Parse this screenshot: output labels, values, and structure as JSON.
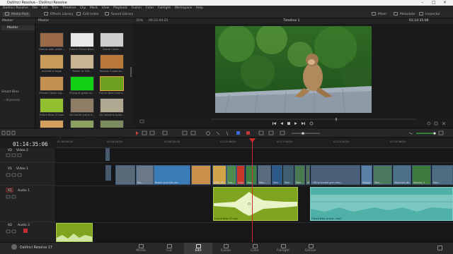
{
  "titlebar": {
    "title": "DaVinci Resolve - DaVinci Resolve"
  },
  "menu": [
    "DaVinci Resolve",
    "File",
    "Edit",
    "Trim",
    "Timeline",
    "Clip",
    "Mark",
    "View",
    "Playback",
    "Fusion",
    "Color",
    "Fairlight",
    "Workspace",
    "Help"
  ],
  "toolbar": {
    "media_pool": "Media Pool",
    "effects_library": "Effects Library",
    "edit_index": "Edit Index",
    "sound_library": "Sound Library",
    "mixer": "Mixer",
    "metadata": "Metadata",
    "inspector": "Inspector"
  },
  "bins": {
    "header": "Master",
    "selected": "Master",
    "smart_bins": "Smart Bins",
    "keywords": "Keywords"
  },
  "media_pool": {
    "header": "Master",
    "clips": [
      {
        "label": "Donuts with white...",
        "color": "#9a6a46"
      },
      {
        "label": "Dream Future Bass...",
        "color": "#e8e8e8"
      },
      {
        "label": "Drone Cloud...",
        "color": "#cfcfcf"
      },
      {
        "label": "excited to hope",
        "color": "#c89a58"
      },
      {
        "label": "Father to Gift...",
        "color": "#c8b490"
      },
      {
        "label": "Female Crowd ad...",
        "color": "#b87838"
      },
      {
        "label": "Female Clown ing...",
        "color": "#c49052"
      },
      {
        "label": "Flying at green sc...",
        "color": "#12d012"
      },
      {
        "label": "Future Bass (marri...",
        "color": "#6ea020"
      },
      {
        "label": "Future Bass 07.wav",
        "color": "#93c030"
      },
      {
        "label": "Girl bride scene h...",
        "color": "#8f7d66"
      },
      {
        "label": "Girl blowing bubb...",
        "color": "#b0a890"
      },
      {
        "label": "Girl close up in g...",
        "color": "#d4a060"
      },
      {
        "label": "Girl look shoots jp...",
        "color": "#8ca060"
      },
      {
        "label": "Girl look shoots jp...",
        "color": "#7c8c60"
      },
      {
        "label": "",
        "color": "#6e6e6e"
      },
      {
        "label": "",
        "color": "#5e5e5e"
      },
      {
        "label": "",
        "color": "#8e8e8e"
      }
    ]
  },
  "viewer": {
    "zoom": "35%",
    "timecode_left": "00:22:44:25",
    "timeline_name": "Timeline 1",
    "timecode_right": "01:14:35:06"
  },
  "timeline": {
    "timecode": "01:14:35:06",
    "ruler_ticks": [
      "01:00:00:00",
      "01:04:16:00",
      "01:08:32:00",
      "01:12:48:00",
      "01:17:04:00",
      "01:21:20:00",
      "01:25:36:00"
    ],
    "tracks": [
      {
        "id": "V2",
        "name": "Video 2"
      },
      {
        "id": "V1",
        "name": "Video 1"
      },
      {
        "id": "A1",
        "name": "Audio 1"
      },
      {
        "id": "A2",
        "name": "Audio 2"
      }
    ],
    "video_clips": [
      {
        "label": "",
        "color": "#5a6a78"
      },
      {
        "label": "Riv...",
        "color": "#6a7888"
      },
      {
        "label": "Beach and hills aer...",
        "color": "#3a7cb8"
      },
      {
        "label": "",
        "color": "#c99048"
      },
      {
        "label": "NEW_DE...",
        "color": "#d2a44a"
      },
      {
        "label": "Foo...",
        "color": "#4f8a50"
      },
      {
        "label": "Colo...",
        "color": "#c83828"
      },
      {
        "label": "Mon...",
        "color": "#3c8040"
      },
      {
        "label": "Mon...",
        "color": "#5a6b7e"
      },
      {
        "label": "Mon...",
        "color": "#2c5a88"
      },
      {
        "label": "Mon...",
        "color": "#406070"
      },
      {
        "label": "Mon...",
        "color": "#4a7a52"
      },
      {
        "label": "Mon...",
        "color": "#506e50"
      },
      {
        "label": "Lifting bucket gym mov...",
        "color": "#4a6078"
      },
      {
        "label": "Happy...",
        "color": "#5a82a8"
      },
      {
        "label": "Mon...",
        "color": "#4a7860"
      },
      {
        "label": "Mountain de...",
        "color": "#4e7088"
      },
      {
        "label": "Monkey 2 ...",
        "color": "#3d7a3d"
      },
      {
        "label": "Mon...",
        "color": "#4c6c80"
      }
    ],
    "audio_clips": [
      {
        "label": "Future Bass 07.wav",
        "color": "#7fa520"
      },
      {
        "label": "Future Bass (marri...mp3",
        "color": "#4fb0a8"
      },
      {
        "label": "",
        "color": "#7fa520"
      }
    ]
  },
  "nav": {
    "app": "DaVinci Resolve 17",
    "pages": [
      "Media",
      "Cut",
      "Edit",
      "Fusion",
      "Color",
      "Fairlight",
      "Deliver"
    ],
    "active": "Edit"
  }
}
